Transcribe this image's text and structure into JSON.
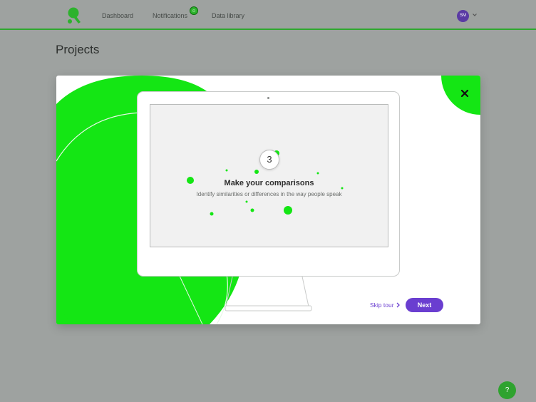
{
  "nav": {
    "items": [
      {
        "label": "Dashboard"
      },
      {
        "label": "Notifications"
      },
      {
        "label": "Data library"
      }
    ],
    "user_initials": "SM"
  },
  "page": {
    "title": "Projects"
  },
  "tour": {
    "step_number": "3",
    "title": "Make your comparisons",
    "description": "Identify similarities or differences in the way people speak",
    "skip_label": "Skip tour",
    "next_label": "Next"
  },
  "help": {
    "label": "?"
  },
  "colors": {
    "brand_green": "#14e614",
    "nav_green": "#2fa82f",
    "accent_purple": "#6a3ed0",
    "backdrop": "#9ea2a0"
  },
  "icons": {
    "logo": "speech-pin-logo-icon",
    "close": "close-icon",
    "chevron": "chevron-right-icon",
    "user_menu": "chevron-down-icon",
    "notification": "notification-dot-icon"
  }
}
